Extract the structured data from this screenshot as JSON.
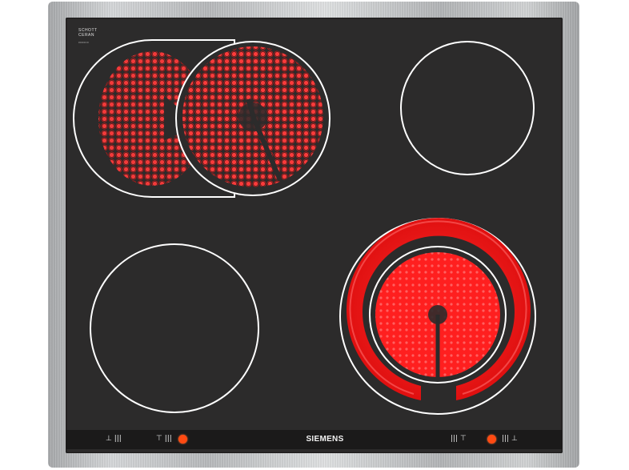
{
  "appliance": {
    "brand": "SIEMENS",
    "glass_logo_line1": "SCHOTT",
    "glass_logo_line2": "CERAN",
    "glass_logo_code": "000000"
  },
  "colors": {
    "glass": "#2c2b2b",
    "heat_red": "#ff1a1a",
    "indicator": "#ff4a12",
    "zone_outline": "#ffffff"
  },
  "zones": [
    {
      "name": "rear-left-extended-zone",
      "state": "on"
    },
    {
      "name": "rear-right-zone",
      "state": "off"
    },
    {
      "name": "front-left-zone",
      "state": "off"
    },
    {
      "name": "front-right-dual-zone",
      "state": "on"
    }
  ],
  "controls": {
    "left_outer_symbol": "⊥ |||",
    "left_inner_symbol": "⊤ |||",
    "right_inner_symbol": "||| ⊤",
    "right_outer_symbol": "||| ⊥"
  }
}
